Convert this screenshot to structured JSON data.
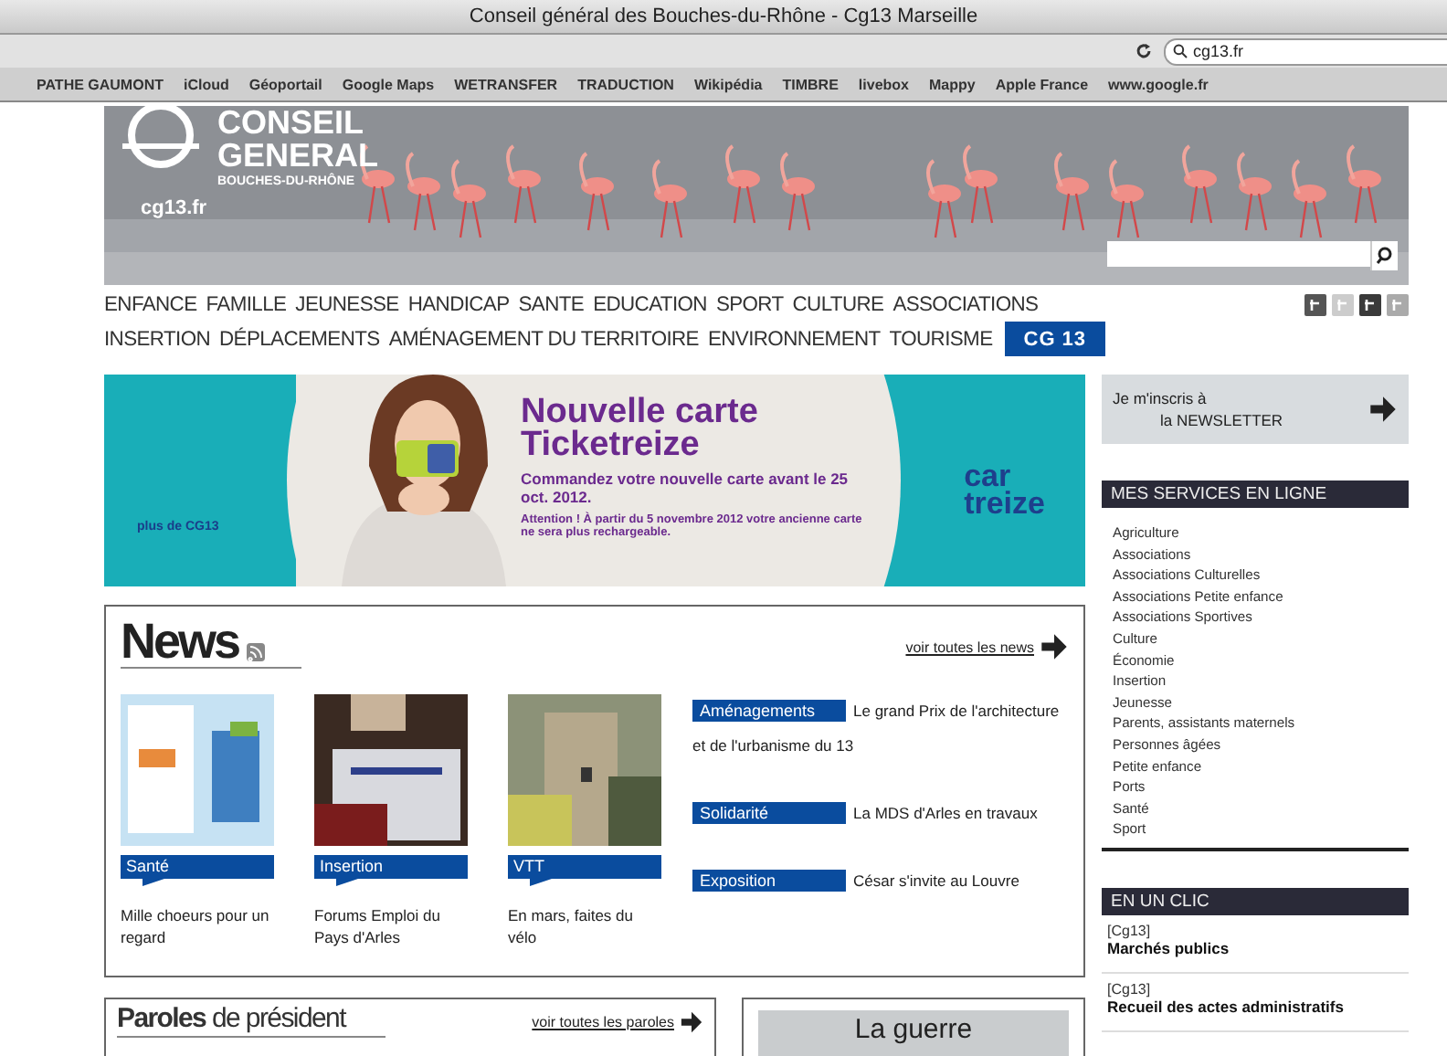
{
  "window": {
    "title": "Conseil général des Bouches-du-Rhône - Cg13 Marseille"
  },
  "address_bar": {
    "search_value": "cg13.fr"
  },
  "bookmarks": [
    "PATHE GAUMONT",
    "iCloud",
    "Géoportail",
    "Google Maps",
    "WETRANSFER",
    "TRADUCTION",
    "Wikipédia",
    "TIMBRE",
    "livebox",
    "Mappy",
    "Apple France",
    "www.google.fr"
  ],
  "header": {
    "logo_title": "CONSEIL GENERAL",
    "logo_subtitle": "BOUCHES-DU-RHÔNE",
    "logo_site": "cg13.fr"
  },
  "nav": {
    "links": [
      {
        "label": "ENFANCE",
        "kind": "link"
      },
      {
        "label": "FAMILLE",
        "kind": "link"
      },
      {
        "label": "JEUNESSE",
        "kind": "link"
      },
      {
        "label": "HANDICAP",
        "kind": "link"
      },
      {
        "label": "SANTE",
        "kind": "link"
      },
      {
        "label": "EDUCATION",
        "kind": "link"
      },
      {
        "label": "SPORT",
        "kind": "link"
      },
      {
        "label": "CULTURE",
        "kind": "link"
      },
      {
        "label": "ASSOCIATIONS",
        "kind": "link"
      },
      {
        "label": "INSERTION",
        "kind": "link"
      },
      {
        "label": "DÉPLACEMENTS",
        "kind": "link"
      },
      {
        "label": "AMÉNAGEMENT DU TERRITOIRE",
        "kind": "link"
      },
      {
        "label": "ENVIRONNEMENT",
        "kind": "link"
      },
      {
        "label": "TOURISME",
        "kind": "link"
      },
      {
        "label": "CG 13",
        "kind": "button"
      }
    ]
  },
  "banner": {
    "small_text": "plus de CG13",
    "headline": "Nouvelle carte Ticketreize",
    "subline": "Commandez votre nouvelle carte avant le 25 oct. 2012.",
    "notice": "Attention ! À partir du 5 novembre 2012 votre ancienne carte ne sera plus rechargeable.",
    "logo_top": "car",
    "logo_bottom": "treize"
  },
  "news": {
    "title": "News",
    "link": "voir toutes les news",
    "cards": [
      {
        "category": "Santé",
        "caption": "Mille choeurs pour un regard"
      },
      {
        "category": "Insertion",
        "caption": "Forums Emploi du Pays d'Arles"
      },
      {
        "category": "VTT",
        "caption": "En mars, faites du vélo"
      }
    ],
    "items": [
      {
        "category": "Aménagements",
        "text": "Le grand Prix de l'architecture et de l'urbanisme du 13"
      },
      {
        "category": "Solidarité",
        "text": "La MDS d'Arles en travaux"
      },
      {
        "category": "Exposition",
        "text": "César s'invite au Louvre"
      }
    ]
  },
  "paroles": {
    "title": "**Paroles** de président",
    "link": "voir toutes les paroles"
  },
  "feature": {
    "title": "La guerre"
  },
  "newsletter": {
    "line_1": "Je m'inscris à",
    "line_2": "la NEWSLETTER"
  },
  "services": {
    "title": "MES SERVICES EN LIGNE",
    "items": [
      "Agriculture",
      "Associations",
      "Associations Culturelles",
      "Associations Petite enfance",
      "Associations Sportives",
      "Culture",
      "Économie",
      "Insertion",
      "Jeunesse",
      "Parents, assistants maternels",
      "Personnes âgées",
      "Petite enfance",
      "Ports",
      "Santé",
      "Sport"
    ]
  },
  "en_un_clic": {
    "title": "EN UN CLIC",
    "entries": [
      {
        "source": "[Cg13]",
        "title": "Marchés publics"
      },
      {
        "source": "[Cg13]",
        "title": "Recueil des actes administratifs"
      }
    ]
  }
}
